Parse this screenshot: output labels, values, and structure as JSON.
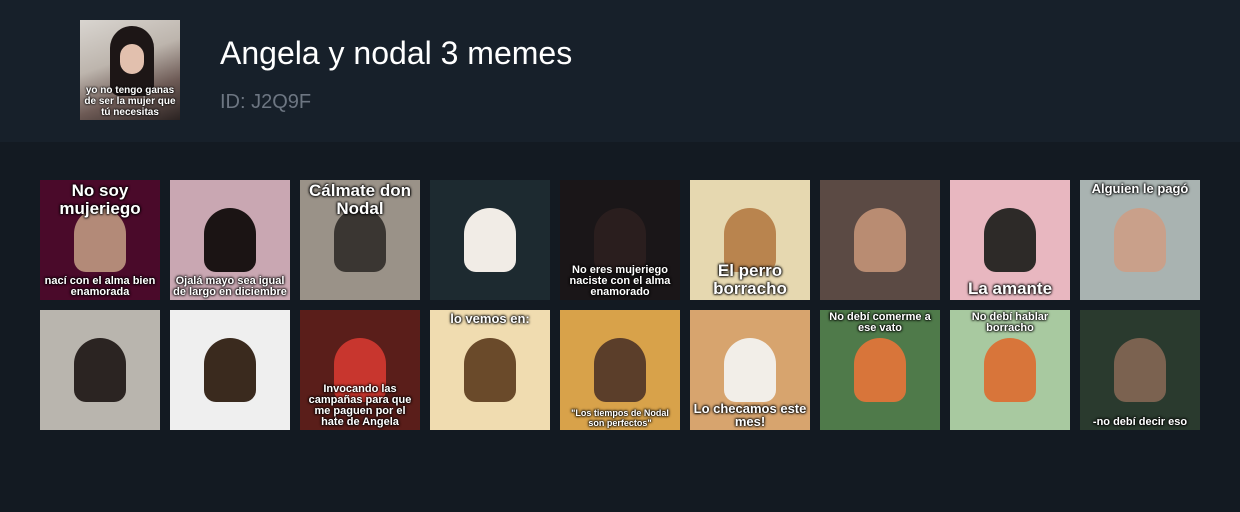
{
  "pack": {
    "title": "Angela y nodal 3 memes",
    "id_text": "ID: J2Q9F",
    "cover_caption": "yo no tengo ganas de ser la mujer que tú necesitas"
  },
  "stickers": [
    {
      "top": "No soy mujeriego",
      "bottom": "nací con el alma bien enamorada",
      "bg": "#4a0a2a",
      "fig": "#b38a78"
    },
    {
      "top": "",
      "bottom": "Ojalá mayo sea igual de largo en diciembre",
      "bg": "#c9a7b2",
      "fig": "#1b1414"
    },
    {
      "top": "Cálmate don Nodal",
      "bottom": "",
      "bg": "#9a9288",
      "fig": "#3a3632"
    },
    {
      "top": "",
      "bottom": "",
      "bg": "#1d2a30",
      "fig": "#f1ece6"
    },
    {
      "top": "",
      "bottom": "No eres mujeriego naciste con el alma enamorado",
      "bg": "#1a1618",
      "fig": "#2a1e1e"
    },
    {
      "top": "",
      "bottom": "El perro borracho",
      "bg": "#e6d8b0",
      "fig": "#b9844e"
    },
    {
      "top": "",
      "bottom": "",
      "bg": "#5b4a44",
      "fig": "#b98c72"
    },
    {
      "top": "",
      "bottom": "La amante",
      "bg": "#e8b7c0",
      "fig": "#2d2a28"
    },
    {
      "top": "Alguien le pagó",
      "bottom": "",
      "bg": "#a9b3b1",
      "fig": "#c9a08a"
    },
    {
      "top": "",
      "bottom": "",
      "bg": "#b9b5ae",
      "fig": "#2b2422"
    },
    {
      "top": "",
      "bottom": "",
      "bg": "#efefef",
      "fig": "#3a2a1e"
    },
    {
      "top": "",
      "bottom": "Invocando las campañas para que me paguen por el hate de Angela",
      "bg": "#5a1e1a",
      "fig": "#c8362e"
    },
    {
      "top": "lo vemos en:",
      "bottom": "",
      "bg": "#f0dcb0",
      "fig": "#6a4a2a"
    },
    {
      "top": "",
      "bottom": "\"Los tiempos de Nodal son perfectos\"",
      "bg": "#d8a24a",
      "fig": "#5b3e2a"
    },
    {
      "top": "",
      "bottom": "Lo checamos este mes!",
      "bg": "#d7a46e",
      "fig": "#f2eee8"
    },
    {
      "top": "No debí comerme a ese vato",
      "bottom": "",
      "bg": "#4f7a4a",
      "fig": "#d8753a"
    },
    {
      "top": "No debí hablar borracho",
      "bottom": "",
      "bg": "#a8c9a0",
      "fig": "#d8753a"
    },
    {
      "top": "",
      "bottom": "-no debí decir eso",
      "bg": "#2a3a2e",
      "fig": "#7b6250"
    }
  ]
}
